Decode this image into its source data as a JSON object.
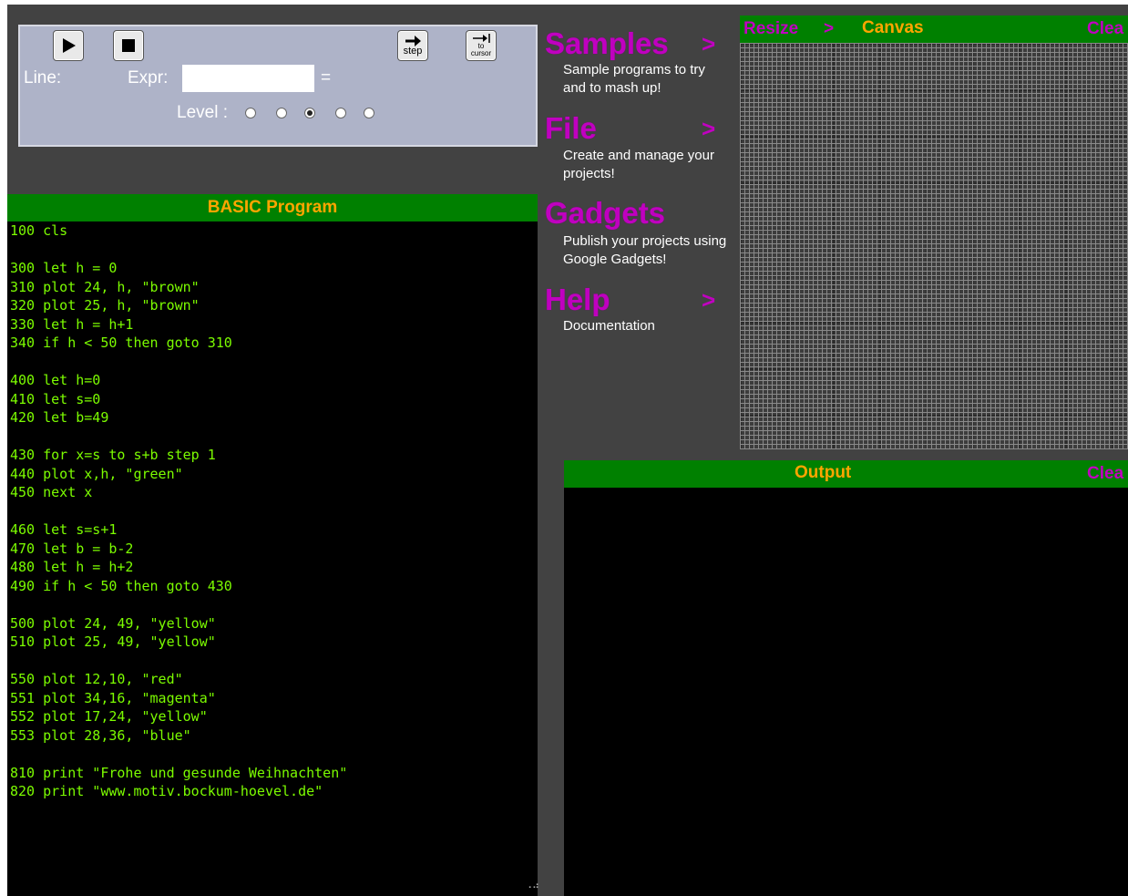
{
  "toolbar": {
    "run_icon": "play-icon",
    "stop_icon": "stop-icon",
    "step_label": "step",
    "to_cursor_label_top": "to",
    "to_cursor_label_bottom": "cursor",
    "line_label": "Line:",
    "expr_label": "Expr:",
    "expr_value": "",
    "equals": "=",
    "level_label": "Level :",
    "level_selected_index": 2,
    "level_count": 5
  },
  "program": {
    "title": "BASIC Program",
    "lines": [
      "100 cls",
      "",
      "300 let h = 0",
      "310 plot 24, h, \"brown\"",
      "320 plot 25, h, \"brown\"",
      "330 let h = h+1",
      "340 if h < 50 then goto 310",
      "",
      "400 let h=0",
      "410 let s=0",
      "420 let b=49",
      "",
      "430 for x=s to s+b step 1",
      "440 plot x,h, \"green\"",
      "450 next x",
      "",
      "460 let s=s+1",
      "470 let b = b-2",
      "480 let h = h+2",
      "490 if h < 50 then goto 430",
      "",
      "500 plot 24, 49, \"yellow\"",
      "510 plot 25, 49, \"yellow\"",
      "",
      "550 plot 12,10, \"red\"",
      "551 plot 34,16, \"magenta\"",
      "552 plot 17,24, \"yellow\"",
      "553 plot 28,36, \"blue\"",
      "",
      "810 print \"Frohe und gesunde Weihnachten\"",
      "820 print \"www.motiv.bockum-hoevel.de\""
    ]
  },
  "menu": {
    "samples": {
      "title": "Samples",
      "arrow": ">",
      "desc": "Sample programs to try and to mash up!"
    },
    "file": {
      "title": "File",
      "arrow": ">",
      "desc": "Create and manage your projects!"
    },
    "gadgets": {
      "title": "Gadgets",
      "desc": "Publish your projects using Google Gadgets!"
    },
    "help": {
      "title": "Help",
      "arrow": ">",
      "desc": "Documentation"
    }
  },
  "canvas": {
    "resize_label": "Resize",
    "resize_arrow": ">",
    "title": "Canvas",
    "clear_label": "Clea"
  },
  "output": {
    "title": "Output",
    "clear_label": "Clea",
    "text": ""
  },
  "colors": {
    "header_bg": "#008000",
    "header_text": "#ffa500",
    "menu_accent": "#c000c0",
    "code_text": "#7cfc00",
    "app_bg": "#424242",
    "toolbar_bg": "#aeb3c8"
  }
}
